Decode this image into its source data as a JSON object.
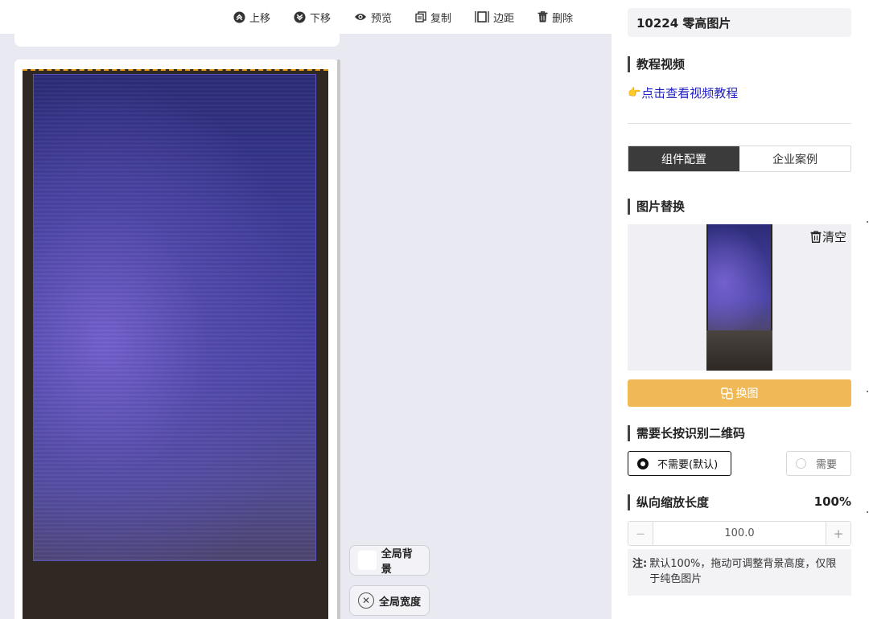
{
  "toolbar": {
    "items": [
      {
        "label": "上移",
        "icon": "move-up-icon"
      },
      {
        "label": "下移",
        "icon": "move-down-icon"
      },
      {
        "label": "预览",
        "icon": "eye-icon"
      },
      {
        "label": "复制",
        "icon": "copy-icon"
      },
      {
        "label": "边距",
        "icon": "margin-icon"
      },
      {
        "label": "删除",
        "icon": "trash-icon"
      }
    ]
  },
  "canvas": {
    "float_buttons": {
      "bg_label": "全局背景",
      "width_label": "全局宽度"
    }
  },
  "panel": {
    "title": "10224 零高图片",
    "tutorial": {
      "heading": "教程视频",
      "link_icon": "👉",
      "link": "点击查看视频教程"
    },
    "tabs": [
      {
        "label": "组件配置",
        "active": true
      },
      {
        "label": "企业案例",
        "active": false
      }
    ],
    "image_replace": {
      "heading": "图片替换",
      "clear": "清空",
      "swap": "换图"
    },
    "qrcode": {
      "heading": "需要长按识别二维码",
      "options": [
        {
          "label": "不需要(默认)",
          "selected": true
        },
        {
          "label": "需要",
          "selected": false
        }
      ]
    },
    "scale": {
      "heading": "纵向缩放长度",
      "percent": "100%",
      "value": "100.0",
      "minus": "−",
      "plus": "+"
    },
    "note": {
      "key": "注:",
      "text": "默认100%，拖动可调整背景高度，仅限于纯色图片"
    }
  },
  "colors": {
    "swap_button": "#f0b955",
    "active_tab": "#3b3b3b",
    "link": "#2020c0",
    "canvas_bg": "#e9e9f2"
  }
}
